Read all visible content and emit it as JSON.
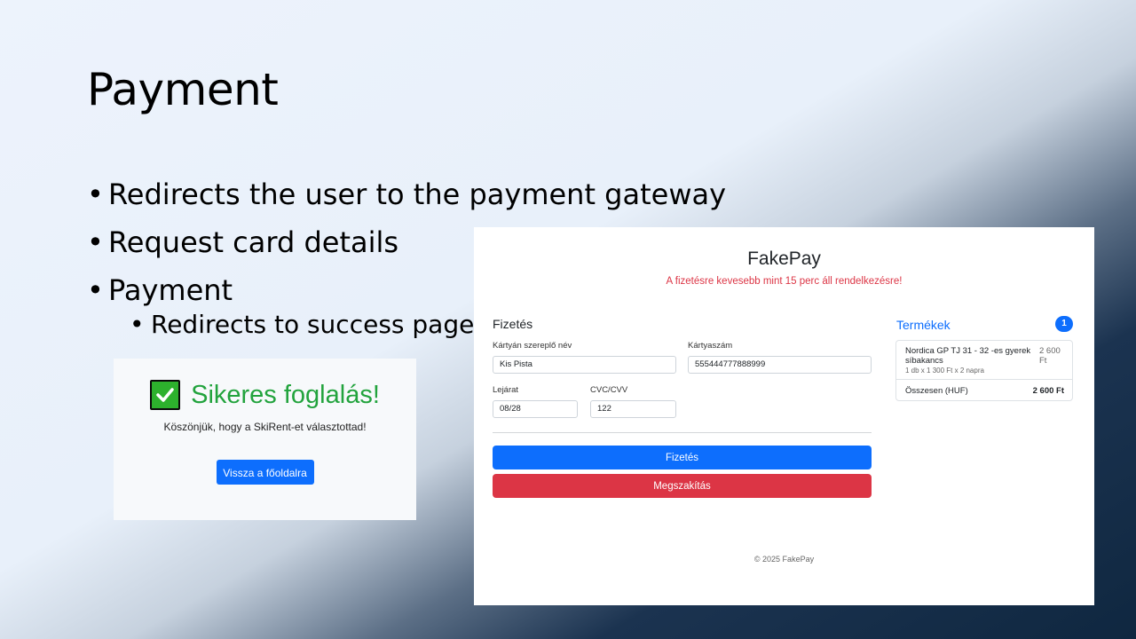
{
  "slide": {
    "title": "Payment",
    "bullets": [
      "Redirects the user to the payment gateway",
      "Request card details",
      "Payment"
    ],
    "sub_bullets": [
      "Redirects to success page"
    ]
  },
  "success": {
    "title": "Sikeres foglalás!",
    "icon": "check-mark-icon",
    "message": "Köszönjük, hogy a SkiRent-et választottad!",
    "home_button": "Vissza a főoldalra"
  },
  "fakepay": {
    "brand": "FakePay",
    "warning": "A fizetésre kevesebb mint 15 perc áll rendelkezésre!",
    "form": {
      "title": "Fizetés",
      "cardholder_label": "Kártyán szereplő név",
      "cardholder_value": "Kis Pista",
      "card_number_label": "Kártyaszám",
      "card_number_value": "555444777888999",
      "expiry_label": "Lejárat",
      "expiry_value": "08/28",
      "cvc_label": "CVC/CVV",
      "cvc_value": "122",
      "pay_button": "Fizetés",
      "cancel_button": "Megszakítás"
    },
    "cart": {
      "title": "Termékek",
      "count": "1",
      "items": [
        {
          "name": "Nordica GP TJ 31 - 32 -es gyerek síbakancs",
          "detail": "1 db x 1 300 Ft x 2 napra",
          "price": "2 600 Ft"
        }
      ],
      "total_label": "Összesen (HUF)",
      "total_value": "2 600 Ft"
    },
    "footer": "© 2025 FakePay"
  },
  "colors": {
    "primary": "#0d6efd",
    "danger": "#dc3545",
    "success": "#22a33d"
  }
}
